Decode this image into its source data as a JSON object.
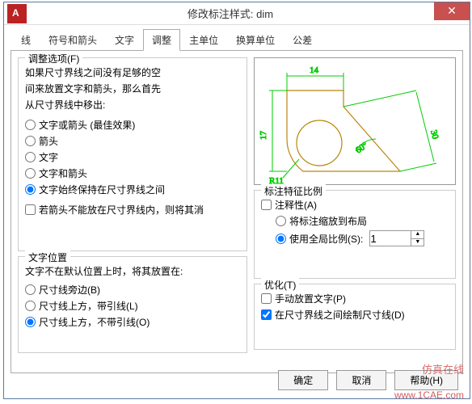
{
  "title": "修改标注样式: dim",
  "close": "✕",
  "tabs": [
    "线",
    "符号和箭头",
    "文字",
    "调整",
    "主单位",
    "换算单位",
    "公差"
  ],
  "active_tab": 3,
  "fit_options": {
    "legend": "调整选项(F)",
    "intro1": "如果尺寸界线之间没有足够的空",
    "intro2": "间来放置文字和箭头，那么首先",
    "intro3": "从尺寸界线中移出:",
    "r1": "文字或箭头 (最佳效果)",
    "r2": "箭头",
    "r3": "文字",
    "r4": "文字和箭头",
    "r5": "文字始终保持在尺寸界线之间",
    "c1": "若箭头不能放在尺寸界线内，则将其消"
  },
  "text_pos": {
    "legend": "文字位置",
    "intro": "文字不在默认位置上时，将其放置在:",
    "r1": "尺寸线旁边(B)",
    "r2": "尺寸线上方，带引线(L)",
    "r3": "尺寸线上方，不带引线(O)"
  },
  "scale": {
    "legend": "标注特征比例",
    "c1": "注释性(A)",
    "r1": "将标注缩放到布局",
    "r2": "使用全局比例(S):",
    "value": "1"
  },
  "tune": {
    "legend": "优化(T)",
    "c1": "手动放置文字(P)",
    "c2": "在尺寸界线之间绘制尺寸线(D)"
  },
  "preview": {
    "d14": "14",
    "d17": "17",
    "d30": "30",
    "a60": "60°",
    "r11": "R11"
  },
  "buttons": {
    "ok": "确定",
    "cancel": "取消",
    "help": "帮助(H)"
  },
  "watermark": "仿真在线",
  "watermark2": "www.1CAE.com"
}
